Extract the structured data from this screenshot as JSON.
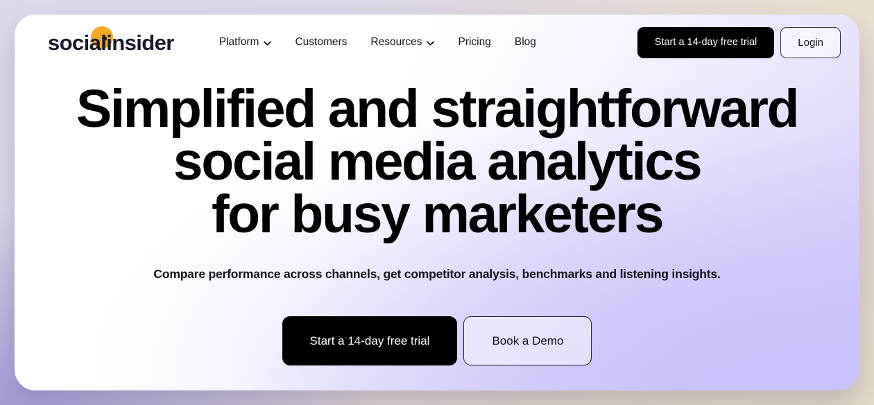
{
  "brand": {
    "name": "socialinsider",
    "logo_text": "socialinsider",
    "accent_color": "#f7a81f",
    "text_color": "#191a2e"
  },
  "nav": {
    "items": [
      {
        "label": "Platform",
        "has_dropdown": true,
        "icon": "chevron-down-icon"
      },
      {
        "label": "Customers",
        "has_dropdown": false,
        "icon": ""
      },
      {
        "label": "Resources",
        "has_dropdown": true,
        "icon": "chevron-down-icon"
      },
      {
        "label": "Pricing",
        "has_dropdown": false,
        "icon": ""
      },
      {
        "label": "Blog",
        "has_dropdown": false,
        "icon": ""
      }
    ],
    "actions": {
      "trial_label": "Start a 14-day free trial",
      "login_label": "Login"
    }
  },
  "hero": {
    "title_lines": [
      "Simplified and straightforward",
      "social media analytics",
      "for busy marketers"
    ],
    "subtitle": "Compare performance across channels, get competitor analysis, benchmarks and listening insights.",
    "cta_primary": "Start a 14-day free trial",
    "cta_secondary": "Book a Demo"
  },
  "theme": {
    "card_bg_start": "#ffffff",
    "card_bg_end": "#ddd5fb",
    "page_bg_purple": "#a79cd6",
    "page_bg_beige": "#e9e0cd",
    "button_primary_bg": "#000000",
    "button_primary_text": "#ffffff"
  }
}
